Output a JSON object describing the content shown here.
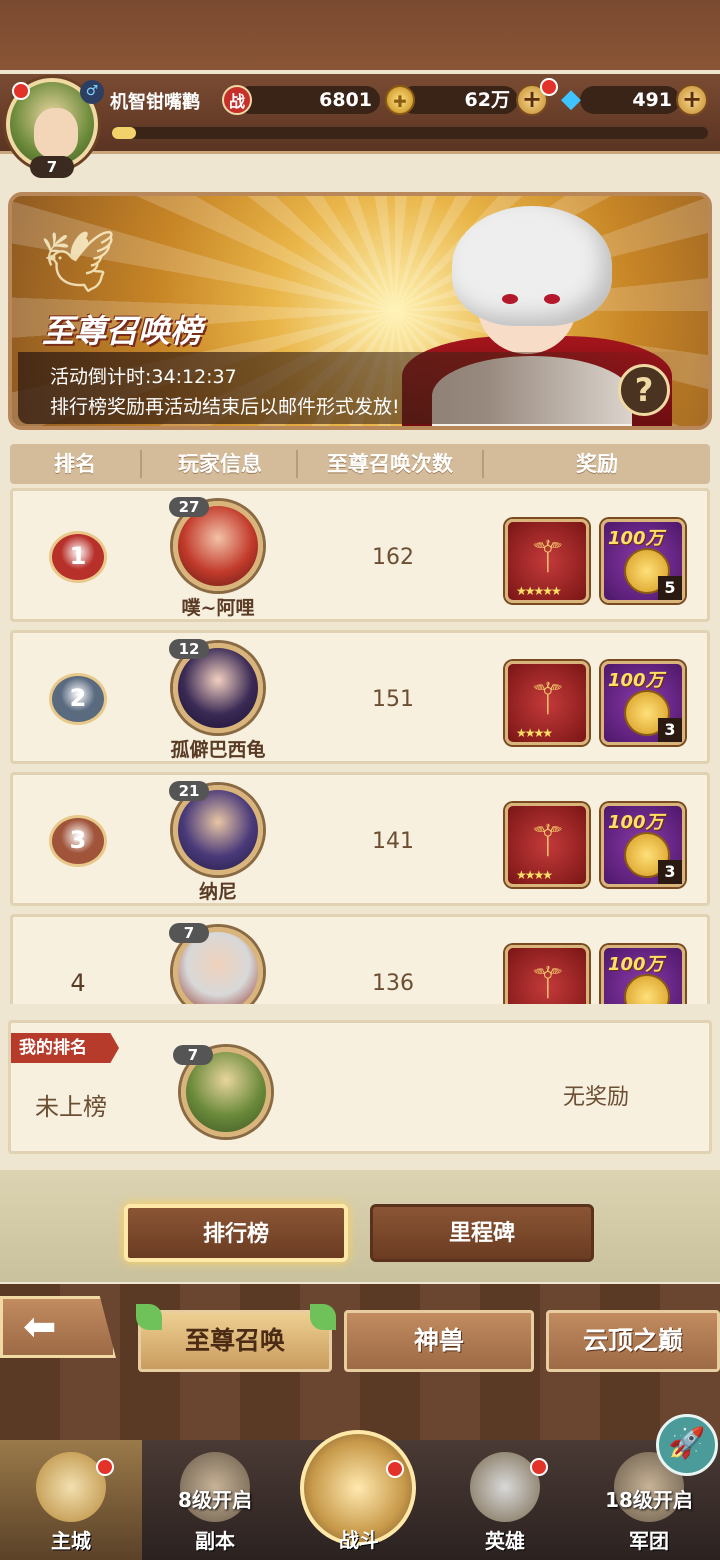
{
  "player": {
    "name": "机智钳嘴鹳",
    "level": "7",
    "power_icon": "战",
    "power": "6801",
    "gold": "62万",
    "gems": "491",
    "xp_fraction": 0.04
  },
  "banner": {
    "title": "至尊召唤榜",
    "countdown": "活动倒计时:34:12:37",
    "note": "排行榜奖励再活动结束后以邮件形式发放!",
    "help": "?"
  },
  "table": {
    "headers": [
      "排名",
      "玩家信息",
      "至尊召唤次数",
      "奖励"
    ]
  },
  "rows": [
    {
      "rank": "1",
      "level": "27",
      "name": "噗~阿哩",
      "count": "162",
      "coin_label": "100万",
      "coin_qty": "5",
      "stars": "★★★★★",
      "medal_color": "#b8302a"
    },
    {
      "rank": "2",
      "level": "12",
      "name": "孤僻巴西龟",
      "count": "151",
      "coin_label": "100万",
      "coin_qty": "3",
      "stars": "★★★★",
      "medal_color": "#5a6b80"
    },
    {
      "rank": "3",
      "level": "21",
      "name": "纳尼",
      "count": "141",
      "coin_label": "100万",
      "coin_qty": "3",
      "stars": "★★★★",
      "medal_color": "#a0543a"
    },
    {
      "rank": "4",
      "level": "7",
      "name": "",
      "count": "136",
      "coin_label": "100万",
      "coin_qty": "",
      "stars": "",
      "medal_color": ""
    }
  ],
  "my_rank": {
    "tag": "我的排名",
    "status": "未上榜",
    "level": "7",
    "reward": "无奖励"
  },
  "buttons": {
    "leaderboard": "排行榜",
    "milestone": "里程碑"
  },
  "signs": {
    "supreme": "至尊召唤",
    "beast": "神兽",
    "cloud": "云顶之巅"
  },
  "nav": [
    {
      "label": "主城",
      "lock": ""
    },
    {
      "label": "副本",
      "lock": "8级开启"
    },
    {
      "label": "战斗",
      "lock": ""
    },
    {
      "label": "英雄",
      "lock": ""
    },
    {
      "label": "军团",
      "lock": "18级开启"
    }
  ]
}
